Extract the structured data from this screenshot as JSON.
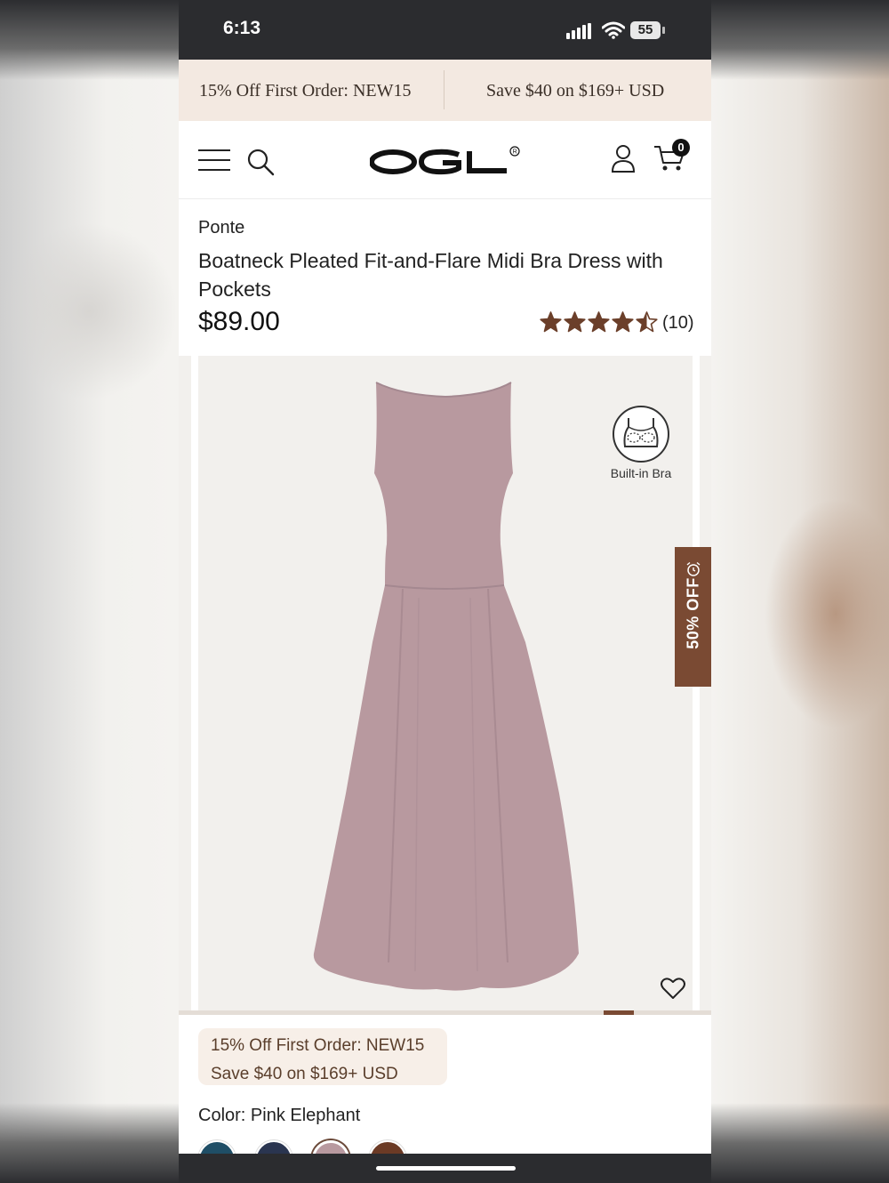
{
  "status_bar": {
    "time": "6:13",
    "battery": "55"
  },
  "promo_bar": {
    "left": "15% Off First Order: NEW15",
    "right": "Save $40 on $169+ USD"
  },
  "header": {
    "logo": "OGL",
    "cart_count": "0"
  },
  "product": {
    "collection": "Ponte",
    "title": "Boatneck Pleated Fit-and-Flare Midi Bra Dress with Pockets",
    "price": "$89.00",
    "rating": 4.5,
    "review_count": "(10)"
  },
  "gallery": {
    "badge_label": "Built-in Bra",
    "sale_tab": "50% OFF",
    "dress_color": "#b8999f"
  },
  "promo_chip": {
    "line1": "15% Off First Order: NEW15",
    "line2": "Save $40 on $169+ USD"
  },
  "color": {
    "label": "Color: Pink Elephant"
  },
  "swatches": [
    {
      "name": "teal",
      "color": "#1f4e66"
    },
    {
      "name": "navy",
      "color": "#2a3550"
    },
    {
      "name": "pink-elephant",
      "color": "#b8999f",
      "selected": true
    },
    {
      "name": "brown",
      "color": "#6b3a25"
    }
  ],
  "colors": {
    "accent": "#7a4a33",
    "promo_bg": "#f3e9e1",
    "star": "#6b3f2a"
  }
}
